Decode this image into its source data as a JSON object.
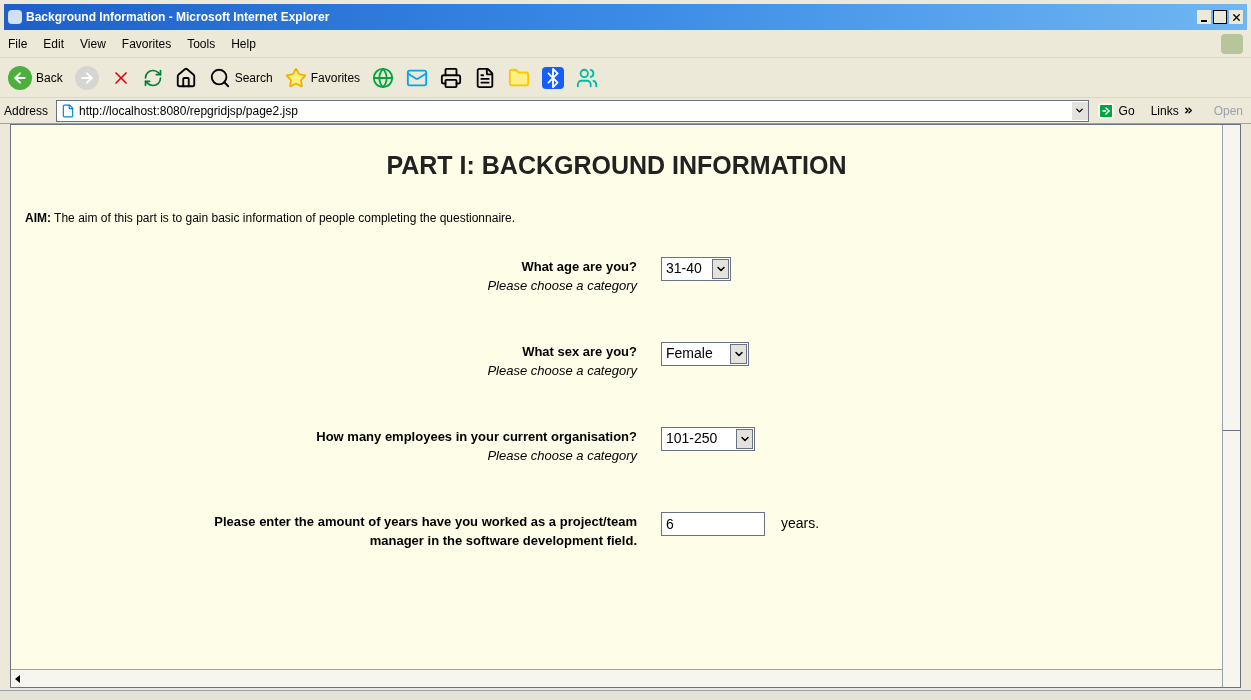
{
  "window": {
    "title": "Background Information - Microsoft Internet Explorer"
  },
  "menu": [
    "File",
    "Edit",
    "View",
    "Favorites",
    "Tools",
    "Help"
  ],
  "toolbar": {
    "back": "Back",
    "search": "Search",
    "favorites": "Favorites"
  },
  "address_bar": {
    "label": "Address",
    "url": "http://localhost:8080/repgridjsp/page2.jsp",
    "go": "Go",
    "links": "Links",
    "open": {
      "label": "Open",
      "disabled": true
    }
  },
  "page": {
    "heading": "PART I: BACKGROUND INFORMATION",
    "aim": "**AIM:** The aim of this part is to gain basic information of people completing the questionnaire.",
    "questions": [
      {
        "kind": "select",
        "question": "What age are you?",
        "hint": "Please choose a category",
        "value": "31-40"
      },
      {
        "kind": "select",
        "question": "What sex are you?",
        "hint": "Please choose a category",
        "value": "Female"
      },
      {
        "kind": "select",
        "question": "How many employees in your current organisation?",
        "hint": "Please choose a category",
        "value": "101-250"
      },
      {
        "kind": "text",
        "question": "Please enter the amount of years have you worked as a project/team manager in the software development field.",
        "value": "6",
        "suffix": "years."
      }
    ]
  }
}
